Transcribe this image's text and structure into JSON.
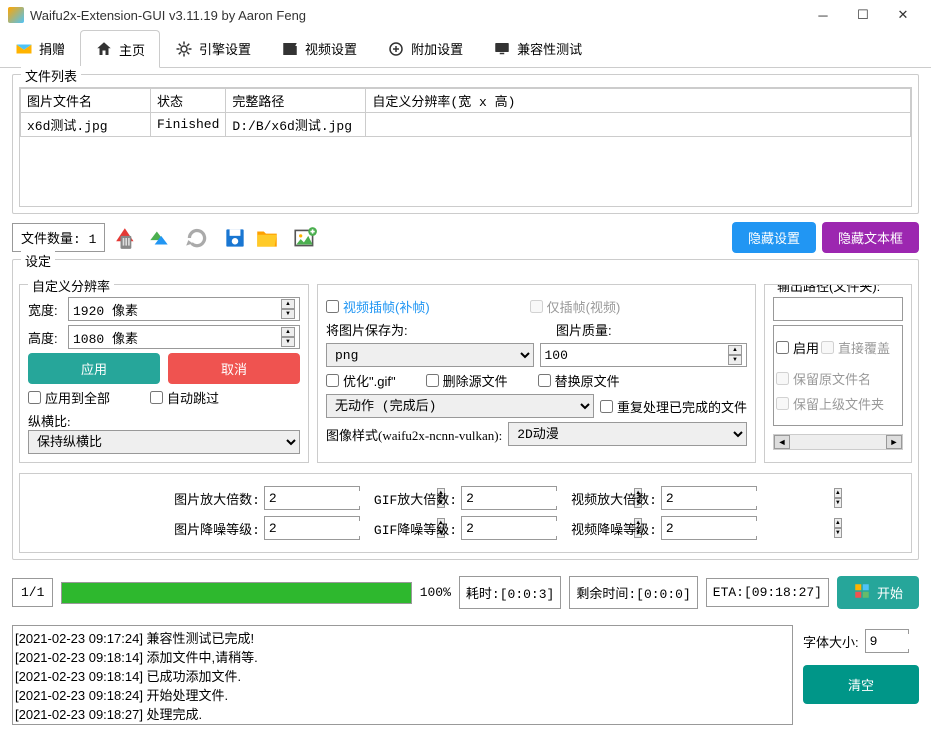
{
  "window": {
    "title": "Waifu2x-Extension-GUI v3.11.19 by Aaron Feng"
  },
  "tabs": {
    "donate": "捐赠",
    "home": "主页",
    "engine": "引擎设置",
    "video": "视频设置",
    "addon": "附加设置",
    "compat": "兼容性测试"
  },
  "fileList": {
    "legend": "文件列表",
    "headers": {
      "name": "图片文件名",
      "status": "状态",
      "path": "完整路径",
      "res": "自定义分辨率(宽 x 高)"
    },
    "row": {
      "name": "x6d测试.jpg",
      "status": "Finished",
      "path": "D:/B/x6d测试.jpg",
      "res": ""
    },
    "count": "文件数量: 1"
  },
  "buttons": {
    "hideSettings": "隐藏设置",
    "hideTextbox": "隐藏文本框",
    "apply": "应用",
    "cancel": "取消",
    "start": "开始",
    "clear": "清空"
  },
  "settings": {
    "legend": "设定",
    "customRes": {
      "legend": "自定义分辨率",
      "widthLabel": "宽度:",
      "widthVal": "1920 像素",
      "heightLabel": "高度:",
      "heightVal": "1080 像素",
      "applyAll": "应用到全部",
      "autoSkip": "自动跳过",
      "aspectLabel": "纵横比:",
      "aspectVal": "保持纵横比"
    },
    "middle": {
      "videoInterp": "视频插帧(补帧)",
      "onlyInterp": "仅插帧(视频)",
      "saveAsLabel": "将图片保存为:",
      "saveAsVal": "png",
      "qualityLabel": "图片质量:",
      "qualityVal": "100",
      "optGif": "优化\".gif\"",
      "delSrc": "删除源文件",
      "replaceSrc": "替换原文件",
      "afterActionVal": "无动作 (完成后)",
      "reprocess": "重复处理已完成的文件",
      "imgStyleLabel": "图像样式(waifu2x-ncnn-vulkan):",
      "imgStyleVal": "2D动漫"
    },
    "output": {
      "legend": "输出路径(文件夹):",
      "enable": "启用",
      "overwrite": "直接覆盖",
      "keepName": "保留原文件名",
      "keepParent": "保留上级文件夹"
    },
    "scale": {
      "imgScale": "图片放大倍数:",
      "imgScaleVal": "2",
      "imgDenoise": "图片降噪等级:",
      "imgDenoiseVal": "2",
      "gifScale": "GIF放大倍数:",
      "gifScaleVal": "2",
      "gifDenoise": "GIF降噪等级:",
      "gifDenoiseVal": "2",
      "vidScale": "视频放大倍数:",
      "vidScaleVal": "2",
      "vidDenoise": "视频降噪等级:",
      "vidDenoiseVal": "2"
    }
  },
  "progress": {
    "count": "1/1",
    "pct": "100%",
    "elapsed": "耗时:[0:0:3]",
    "remain": "剩余时间:[0:0:0]",
    "eta": "ETA:[09:18:27]"
  },
  "log": {
    "lines": [
      "[2021-02-23 09:17:24] 兼容性测试已完成!",
      "[2021-02-23 09:18:14] 添加文件中,请稍等.",
      "[2021-02-23 09:18:14] 已成功添加文件.",
      "[2021-02-23 09:18:24] 开始处理文件.",
      "[2021-02-23 09:18:27] 处理完成."
    ],
    "fontLabel": "字体大小:",
    "fontVal": "9"
  }
}
